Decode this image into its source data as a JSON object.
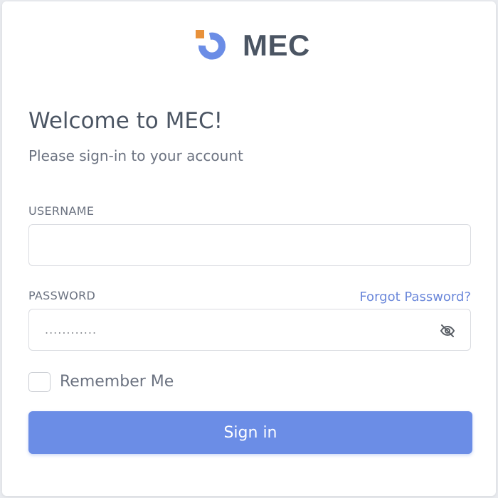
{
  "brand": {
    "name": "MEC",
    "colors": {
      "accent": "#6b8de6",
      "logo_square": "#e8913a"
    }
  },
  "header": {
    "title": "Welcome to MEC!",
    "subtitle": "Please sign-in to your account"
  },
  "form": {
    "username": {
      "label": "USERNAME",
      "value": ""
    },
    "password": {
      "label": "PASSWORD",
      "value": "............",
      "forgot_label": "Forgot Password?",
      "toggle_icon": "eye-off-icon"
    },
    "remember": {
      "label": "Remember Me",
      "checked": false
    },
    "submit_label": "Sign in"
  }
}
